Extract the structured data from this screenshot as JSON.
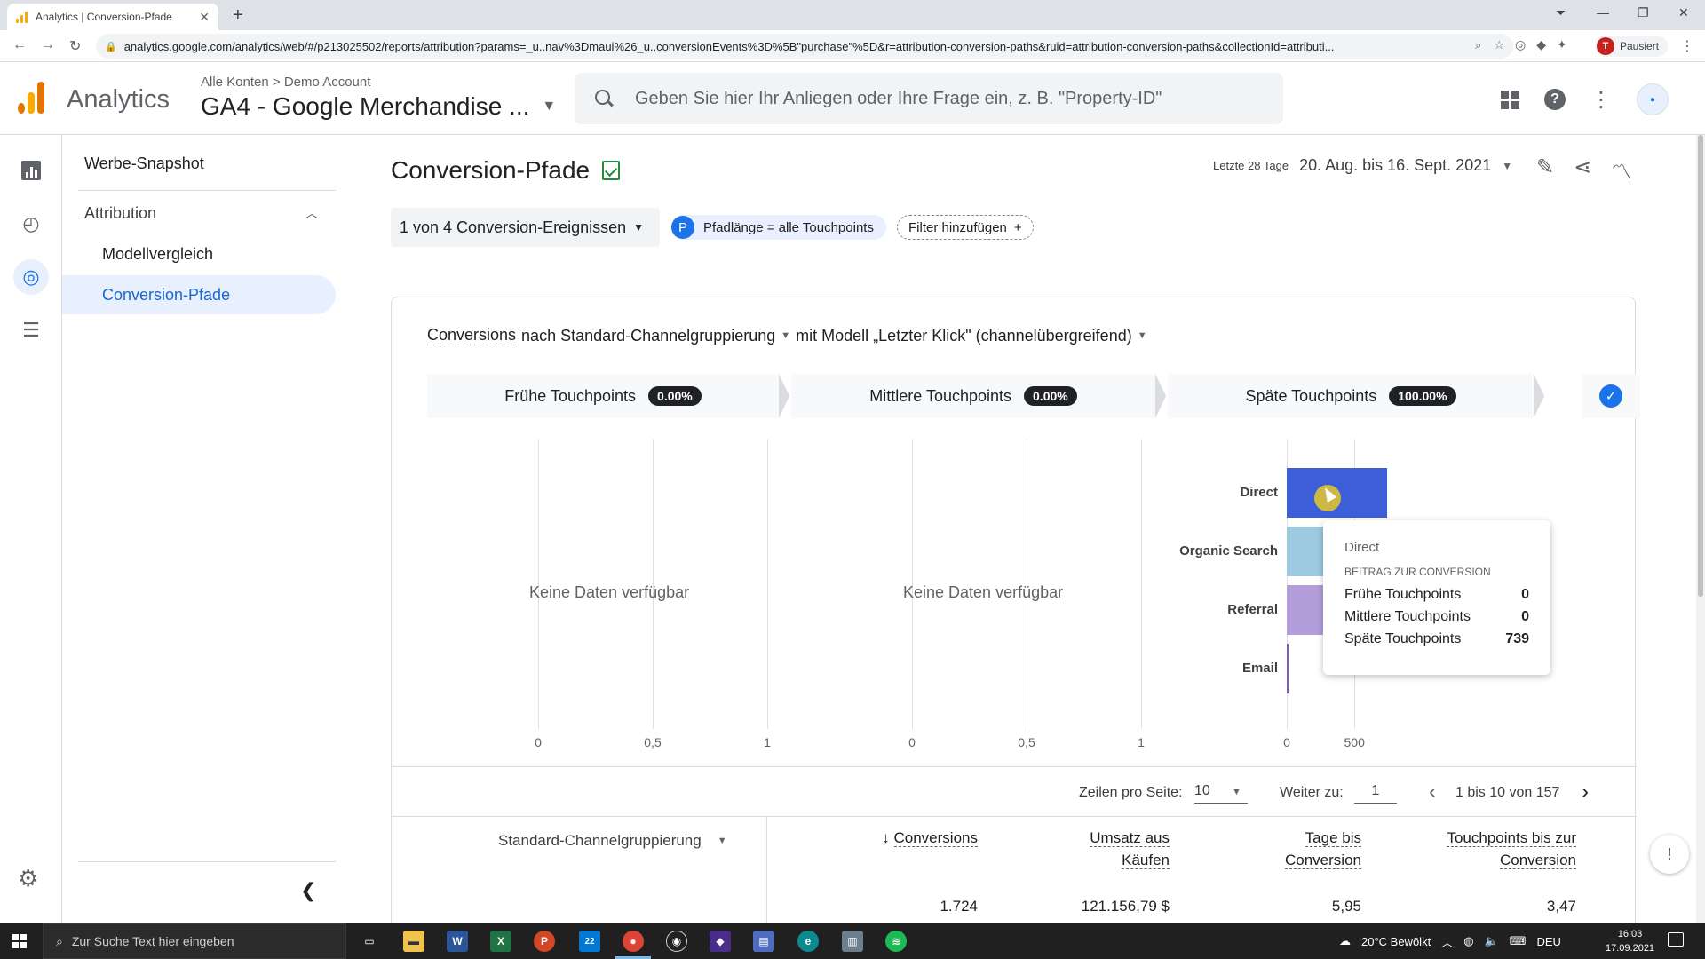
{
  "browser": {
    "tab_title": "Analytics | Conversion-Pfade",
    "url": "analytics.google.com/analytics/web/#/p213025502/reports/attribution?params=_u..nav%3Dmaui%26_u..conversionEvents%3D%5B\"purchase\"%5D&r=attribution-conversion-paths&ruid=attribution-conversion-paths&collectionId=attributi...",
    "profile_initial": "T",
    "profile_status": "Pausiert"
  },
  "header": {
    "app_name": "Analytics",
    "breadcrumb_account": "Alle Konten",
    "breadcrumb_separator": ">",
    "breadcrumb_property": "Demo Account",
    "property_name": "GA4 - Google Merchandise ...",
    "search_placeholder": "Geben Sie hier Ihr Anliegen oder Ihre Frage ein, z. B. \"Property-ID\""
  },
  "sidenav": {
    "title": "Werbe-Snapshot",
    "section": "Attribution",
    "items": [
      {
        "label": "Modellvergleich"
      },
      {
        "label": "Conversion-Pfade"
      }
    ]
  },
  "page": {
    "title": "Conversion-Pfade",
    "date_prefix": "Letzte 28 Tage",
    "date_range": "20. Aug. bis 16. Sept. 2021",
    "event_selector": "1 von 4 Conversion-Ereignissen",
    "filter_badge": "P",
    "filter_label": "Pfadlänge = alle Touchpoints",
    "add_filter": "Filter hinzufügen"
  },
  "card": {
    "metric": "Conversions",
    "by_text": "nach Standard-Channelgruppierung",
    "model_text": "mit Modell „Letzter Klick\" (channelübergreifend)",
    "stages": [
      {
        "label": "Frühe Touchpoints",
        "pct": "0.00%"
      },
      {
        "label": "Mittlere Touchpoints",
        "pct": "0.00%"
      },
      {
        "label": "Späte Touchpoints",
        "pct": "100.00%"
      }
    ],
    "no_data": "Keine Daten verfügbar"
  },
  "chart_data": [
    {
      "type": "bar",
      "title": "Frühe Touchpoints",
      "categories": [],
      "values": [],
      "xticks": [
        "0",
        "0,5",
        "1"
      ],
      "xlim": [
        0,
        1
      ],
      "annotation": "Keine Daten verfügbar"
    },
    {
      "type": "bar",
      "title": "Mittlere Touchpoints",
      "categories": [],
      "values": [],
      "xticks": [
        "0",
        "0,5",
        "1"
      ],
      "xlim": [
        0,
        1
      ],
      "annotation": "Keine Daten verfügbar"
    },
    {
      "type": "bar",
      "orientation": "horizontal",
      "title": "Späte Touchpoints",
      "categories": [
        "Direct",
        "Organic Search",
        "Referral",
        "Email"
      ],
      "values": [
        739,
        530,
        440,
        12
      ],
      "colors": [
        "#3c5fd9",
        "#9ecae1",
        "#b39ddb",
        "#7e57c2"
      ],
      "xticks": [
        "0",
        "500"
      ],
      "xlim": [
        0,
        1050
      ]
    }
  ],
  "tooltip": {
    "title": "Direct",
    "subtitle": "BEITRAG ZUR CONVERSION",
    "rows": [
      {
        "label": "Frühe Touchpoints",
        "value": "0"
      },
      {
        "label": "Mittlere Touchpoints",
        "value": "0"
      },
      {
        "label": "Späte Touchpoints",
        "value": "739"
      }
    ]
  },
  "pager": {
    "rows_label": "Zeilen pro Seite:",
    "rows_value": "10",
    "goto_label": "Weiter zu:",
    "goto_value": "1",
    "range": "1 bis 10 von 157"
  },
  "table": {
    "dimension": "Standard-Channelgruppierung",
    "columns": [
      {
        "line1": "Conversions",
        "line2": ""
      },
      {
        "line1": "Umsatz aus",
        "line2": "Käufen"
      },
      {
        "line1": "Tage bis",
        "line2": "Conversion"
      },
      {
        "line1": "Touchpoints bis zur",
        "line2": "Conversion"
      }
    ],
    "totals": [
      "1.724",
      "121.156,79 $",
      "5,95",
      "3,47"
    ]
  },
  "taskbar": {
    "search_placeholder": "Zur Suche Text hier eingeben",
    "weather": "20°C Bewölkt",
    "lang": "DEU",
    "time": "16:03",
    "date": "17.09.2021",
    "mail_badge": "22"
  }
}
